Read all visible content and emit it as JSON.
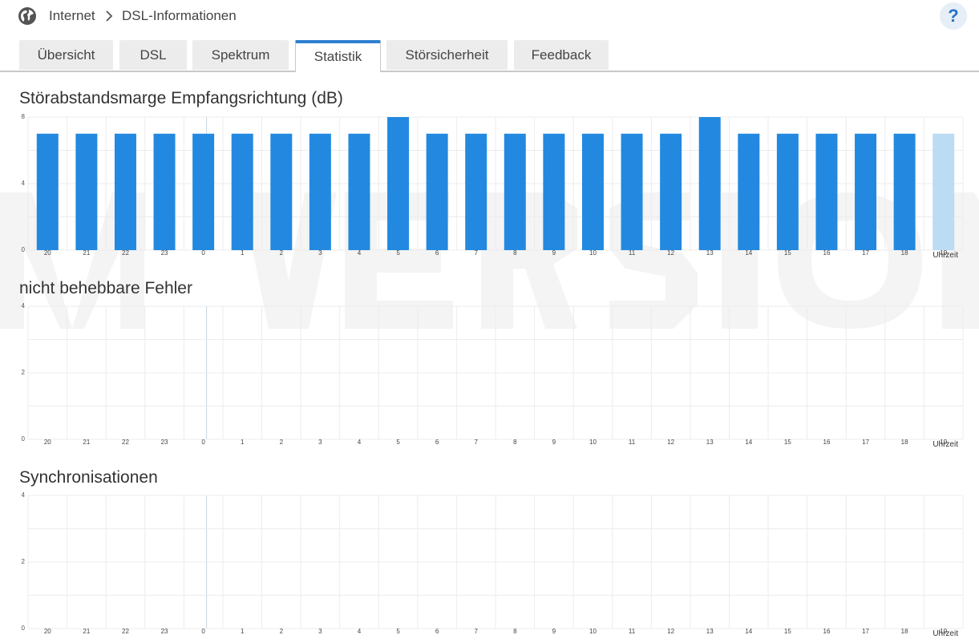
{
  "breadcrumb": {
    "root": "Internet",
    "current": "DSL-Informationen"
  },
  "help": {
    "label": "?"
  },
  "tabs": [
    {
      "label": "Übersicht",
      "active": false
    },
    {
      "label": "DSL",
      "active": false
    },
    {
      "label": "Spektrum",
      "active": false
    },
    {
      "label": "Statistik",
      "active": true
    },
    {
      "label": "Störsicherheit",
      "active": false
    },
    {
      "label": "Feedback",
      "active": false
    }
  ],
  "charts": {
    "snr": {
      "title": "Störabstandsmarge Empfangsrichtung (dB)"
    },
    "errors": {
      "title": "nicht behebbare Fehler"
    },
    "sync": {
      "title": "Synchronisationen"
    }
  },
  "colors": {
    "accent": "#2f7fd1",
    "bar": "#2389e0",
    "bar_current": "#bcdcf4",
    "grid": "#ececec"
  },
  "chart_data": [
    {
      "type": "bar",
      "title": "Störabstandsmarge Empfangsrichtung (dB)",
      "xlabel": "Uhrzeit",
      "categories": [
        "20",
        "21",
        "22",
        "23",
        "0",
        "1",
        "2",
        "3",
        "4",
        "5",
        "6",
        "7",
        "8",
        "9",
        "10",
        "11",
        "12",
        "13",
        "14",
        "15",
        "16",
        "17",
        "18",
        "19"
      ],
      "values": [
        7,
        7,
        7,
        7,
        7,
        7,
        7,
        7,
        7,
        8,
        7,
        7,
        7,
        7,
        7,
        7,
        7,
        8,
        7,
        7,
        7,
        7,
        7,
        7
      ],
      "yticks": [
        "0",
        "4",
        "8"
      ],
      "ylim": [
        0,
        8
      ],
      "grid": true
    },
    {
      "type": "bar",
      "title": "nicht behebbare Fehler",
      "xlabel": "Uhrzeit",
      "categories": [
        "20",
        "21",
        "22",
        "23",
        "0",
        "1",
        "2",
        "3",
        "4",
        "5",
        "6",
        "7",
        "8",
        "9",
        "10",
        "11",
        "12",
        "13",
        "14",
        "15",
        "16",
        "17",
        "18",
        "19"
      ],
      "values": [
        0,
        0,
        0,
        0,
        0,
        0,
        0,
        0,
        0,
        0,
        0,
        0,
        0,
        0,
        0,
        0,
        0,
        0,
        0,
        0,
        0,
        0,
        0,
        0
      ],
      "yticks": [
        "0",
        "2",
        "4"
      ],
      "ylim": [
        0,
        4
      ],
      "grid": true
    },
    {
      "type": "bar",
      "title": "Synchronisationen",
      "xlabel": "Uhrzeit",
      "categories": [
        "20",
        "21",
        "22",
        "23",
        "0",
        "1",
        "2",
        "3",
        "4",
        "5",
        "6",
        "7",
        "8",
        "9",
        "10",
        "11",
        "12",
        "13",
        "14",
        "15",
        "16",
        "17",
        "18",
        "19"
      ],
      "values": [
        0,
        0,
        0,
        0,
        0,
        0,
        0,
        0,
        0,
        0,
        0,
        0,
        0,
        0,
        0,
        0,
        0,
        0,
        0,
        0,
        0,
        0,
        0,
        0
      ],
      "yticks": [
        "0",
        "2",
        "4"
      ],
      "ylim": [
        0,
        4
      ],
      "grid": true
    }
  ]
}
